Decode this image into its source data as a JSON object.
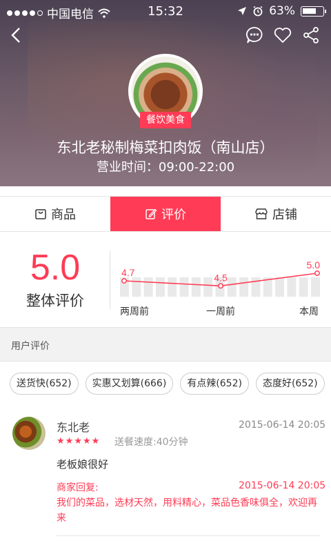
{
  "status_bar": {
    "carrier": "中国电信",
    "time": "15:32",
    "battery": "63%",
    "signal_dots_filled": 4,
    "battery_level": 0.63
  },
  "icons": {
    "back": "back-arrow-icon",
    "chat": "chat-bubble-icon",
    "favorite": "heart-icon",
    "share": "share-icon"
  },
  "shop": {
    "category_tag": "餐饮美食",
    "name": "东北老秘制梅菜扣肉饭（南山店）",
    "hours": "营业时间：09:00-22:00"
  },
  "tabs": [
    {
      "label": "商品",
      "icon": "bag-icon",
      "active": false
    },
    {
      "label": "评价",
      "icon": "edit-icon",
      "active": true
    },
    {
      "label": "店铺",
      "icon": "store-icon",
      "active": false
    }
  ],
  "rating": {
    "score": "5.0",
    "label": "整体评价"
  },
  "chart_data": {
    "type": "line",
    "categories": [
      "两周前",
      "一周前",
      "本周"
    ],
    "series": [
      {
        "values": [
          4.7,
          4.5,
          5.0
        ]
      }
    ],
    "value_labels": [
      "4.7",
      "4.5",
      "5.0"
    ],
    "ylim": [
      0,
      5
    ],
    "bars_count": 17,
    "accent": "#ff3b55"
  },
  "reviews_section": {
    "title": "用户评价",
    "chips": [
      "送货快(652)",
      "实惠又划算(666)",
      "有点辣(652)",
      "态度好(652)"
    ]
  },
  "review": {
    "name": "东北老",
    "date": "2015-06-14 20:05",
    "stars": 5,
    "speed": "送餐速度:40分钟",
    "text": "老板娘很好",
    "reply_label": "商家回复:",
    "reply_date": "2015-06-14 20:05",
    "reply_text": "我们的菜品，选材天然，用料精心，菜品色香味俱全，欢迎再来"
  },
  "colors": {
    "accent": "#ff3b55",
    "header_bg": "#5e4f5e"
  }
}
